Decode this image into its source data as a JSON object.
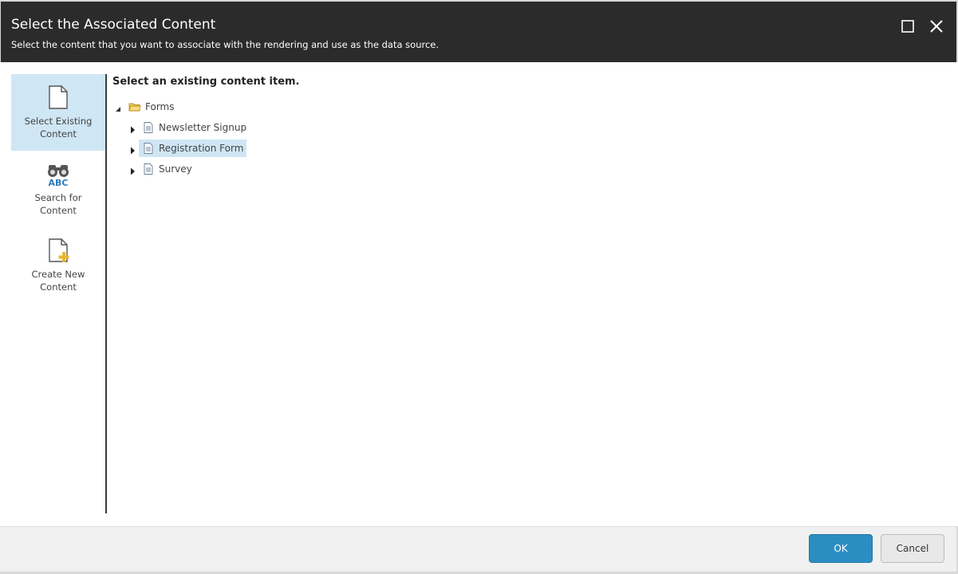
{
  "header": {
    "title": "Select the Associated Content",
    "subtitle": "Select the content that you want to associate with the rendering and use as the data source."
  },
  "sidebar": {
    "items": [
      {
        "label": "Select Existing\nContent",
        "icon": "document-icon",
        "active": true
      },
      {
        "label": "Search for\nContent",
        "icon": "binoculars-abc-icon",
        "active": false
      },
      {
        "label": "Create New\nContent",
        "icon": "document-add-icon",
        "active": false
      }
    ]
  },
  "content": {
    "heading": "Select an existing content item.",
    "tree": {
      "root": {
        "label": "Forms",
        "icon": "folder-icon",
        "expanded": true
      },
      "children": [
        {
          "label": "Newsletter Signup",
          "icon": "form-document-icon",
          "selected": false
        },
        {
          "label": "Registration Form",
          "icon": "form-document-icon",
          "selected": true
        },
        {
          "label": "Survey",
          "icon": "form-document-icon",
          "selected": false
        }
      ]
    }
  },
  "footer": {
    "ok_label": "OK",
    "cancel_label": "Cancel"
  },
  "colors": {
    "header_bg": "#2b2b2b",
    "selection": "#cfe6f4",
    "primary_button": "#2b8ec2"
  }
}
